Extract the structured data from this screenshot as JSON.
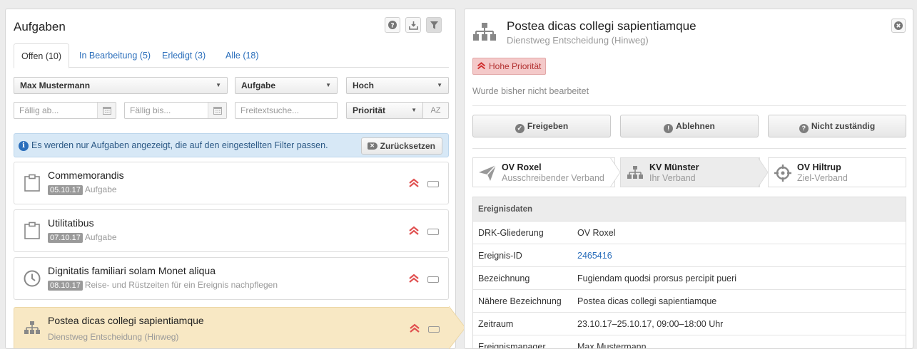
{
  "left": {
    "title": "Aufgaben",
    "tabs": [
      {
        "label": "Offen (10)",
        "active": true
      },
      {
        "label": "In Bearbeitung (5)",
        "active": false
      },
      {
        "label": "Erledigt (3)",
        "active": false
      },
      {
        "label": "Alle (18)",
        "active": false
      }
    ],
    "filters": {
      "person": "Max Mustermann",
      "type": "Aufgabe",
      "priority": "Hoch",
      "due_from_placeholder": "Fällig ab...",
      "due_to_placeholder": "Fällig bis...",
      "search_placeholder": "Freitextsuche...",
      "sort": "Priorität",
      "sort_dir": "AZ"
    },
    "info": {
      "text": "Es werden nur Aufgaben angezeigt, die auf den eingestellten Filter passen.",
      "reset_label": "Zurücksetzen"
    },
    "tasks": [
      {
        "title": "Commemorandis",
        "date": "05.10.17",
        "desc": "Aufgabe",
        "icon": "clipboard-icon"
      },
      {
        "title": "Utilitatibus",
        "date": "07.10.17",
        "desc": "Aufgabe",
        "icon": "clipboard-icon"
      },
      {
        "title": "Dignitatis familiari solam Monet aliqua",
        "date": "08.10.17",
        "desc": "Reise- und Rüstzeiten für ein Ereignis nachpflegen",
        "icon": "clock-icon"
      },
      {
        "title": "Postea dicas collegi sapientiamque",
        "date": "",
        "desc": "Dienstweg Entscheidung (Hinweg)",
        "icon": "hierarchy-icon"
      }
    ]
  },
  "right": {
    "title": "Postea dicas collegi sapientiamque",
    "subtitle": "Dienstweg Entscheidung (Hinweg)",
    "priority_badge": "Hohe Priorität",
    "status": "Wurde bisher nicht bearbeitet",
    "actions": {
      "approve": "Freigeben",
      "reject": "Ablehnen",
      "not_responsible": "Nicht zuständig"
    },
    "steps": [
      {
        "name": "OV Roxel",
        "role": "Ausschreibender Verband",
        "icon": "paper-plane-icon"
      },
      {
        "name": "KV Münster",
        "role": "Ihr Verband",
        "icon": "hierarchy-icon"
      },
      {
        "name": "OV Hiltrup",
        "role": "Ziel-Verband",
        "icon": "crosshair-icon"
      }
    ],
    "event": {
      "header": "Ereignisdaten",
      "rows": [
        {
          "key": "DRK-Gliederung",
          "value": "OV Roxel"
        },
        {
          "key": "Ereignis-ID",
          "value": "2465416"
        },
        {
          "key": "Bezeichnung",
          "value": "Fugiendam quodsi prorsus percipit pueri"
        },
        {
          "key": "Nähere Bezeichnung",
          "value": "Postea dicas collegi sapientiamque"
        },
        {
          "key": "Zeitraum",
          "value": "23.10.17–25.10.17, 09:00–18:00 Uhr"
        },
        {
          "key": "Ereignismanager",
          "value": "Max Mustermann, ..."
        }
      ]
    }
  },
  "colors": {
    "link": "#2a6ebb",
    "priority_red": "#e05050",
    "selected_bg": "#f8e8c4",
    "info_bg": "#d7e8f6"
  }
}
